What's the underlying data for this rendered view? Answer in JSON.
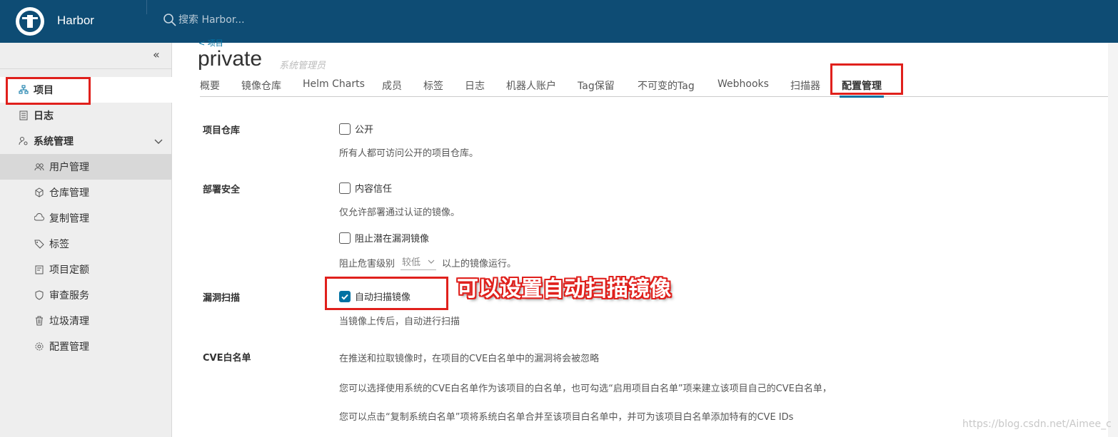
{
  "header": {
    "brand": "Harbor",
    "search_placeholder": "搜索 Harbor..."
  },
  "sidebar": {
    "collapse_icon": "«",
    "items": [
      {
        "label": "项目",
        "icon": "project-icon",
        "active": true
      },
      {
        "label": "日志",
        "icon": "log-icon"
      },
      {
        "label": "系统管理",
        "icon": "admin-icon",
        "expanded": true
      },
      {
        "label": "用户管理",
        "icon": "users-icon",
        "selected": true
      },
      {
        "label": "仓库管理",
        "icon": "registry-icon"
      },
      {
        "label": "复制管理",
        "icon": "replication-icon"
      },
      {
        "label": "标签",
        "icon": "tag-icon"
      },
      {
        "label": "项目定额",
        "icon": "quota-icon"
      },
      {
        "label": "审查服务",
        "icon": "shield-icon"
      },
      {
        "label": "垃圾清理",
        "icon": "trash-icon"
      },
      {
        "label": "配置管理",
        "icon": "gear-icon"
      }
    ]
  },
  "project": {
    "breadcrumb": "< 项目",
    "title": "private",
    "role": "系统管理员"
  },
  "tabs": [
    "概要",
    "镜像仓库",
    "Helm Charts",
    "成员",
    "标签",
    "日志",
    "机器人账户",
    "Tag保留",
    "不可变的Tag",
    "Webhooks",
    "扫描器",
    "配置管理"
  ],
  "active_tab": "配置管理",
  "config": {
    "public_repo": {
      "section": "项目仓库",
      "checkbox": "公开",
      "checked": false,
      "desc": "所有人都可访问公开的项目仓库。"
    },
    "deploy_security": {
      "section": "部署安全",
      "content_trust": "内容信任",
      "content_trust_checked": false,
      "content_trust_desc": "仅允许部署通过认证的镜像。",
      "prevent_vul": "阻止潜在漏洞镜像",
      "prevent_vul_checked": false,
      "severity_prefix": "阻止危害级别",
      "severity_value": "较低",
      "severity_suffix": "以上的镜像运行。"
    },
    "vul_scan": {
      "section": "漏洞扫描",
      "auto_scan": "自动扫描镜像",
      "auto_scan_checked": true,
      "desc": "当镜像上传后，自动进行扫描"
    },
    "cve": {
      "section": "CVE白名单",
      "line1": "在推送和拉取镜像时，在项目的CVE白名单中的漏洞将会被忽略",
      "line2": "您可以选择使用系统的CVE白名单作为该项目的白名单，也可勾选“启用项目白名单”项来建立该项目自己的CVE白名单，",
      "line3": "您可以点击“复制系统白名单”项将系统白名单合并至该项目白名单中，并可为该项目白名单添加特有的CVE IDs"
    }
  },
  "annotation": "可以设置自动扫描镜像",
  "watermark": "https://blog.csdn.net/Aimee_c",
  "colors": {
    "header_bg": "#0e4c74",
    "accent": "#0072a3",
    "annotation_red": "#e0201c"
  }
}
